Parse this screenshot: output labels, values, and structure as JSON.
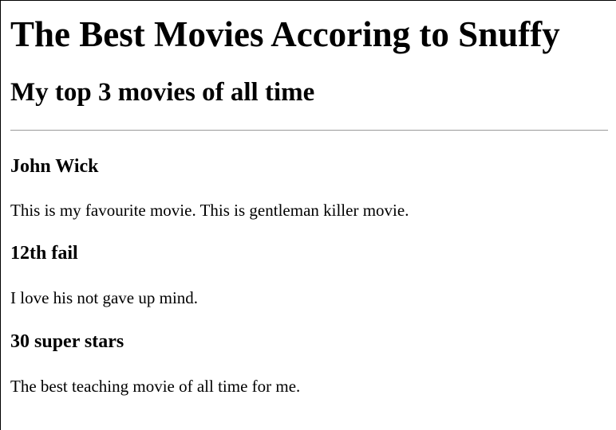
{
  "page": {
    "title": "The Best Movies Accoring to Snuffy",
    "subtitle": "My top 3 movies of all time"
  },
  "movies": [
    {
      "title": "John Wick",
      "description": "This is my favourite movie. This is gentleman killer movie."
    },
    {
      "title": "12th fail",
      "description": "I love his not gave up mind."
    },
    {
      "title": "30 super stars",
      "description": "The best teaching movie of all time for me."
    }
  ]
}
